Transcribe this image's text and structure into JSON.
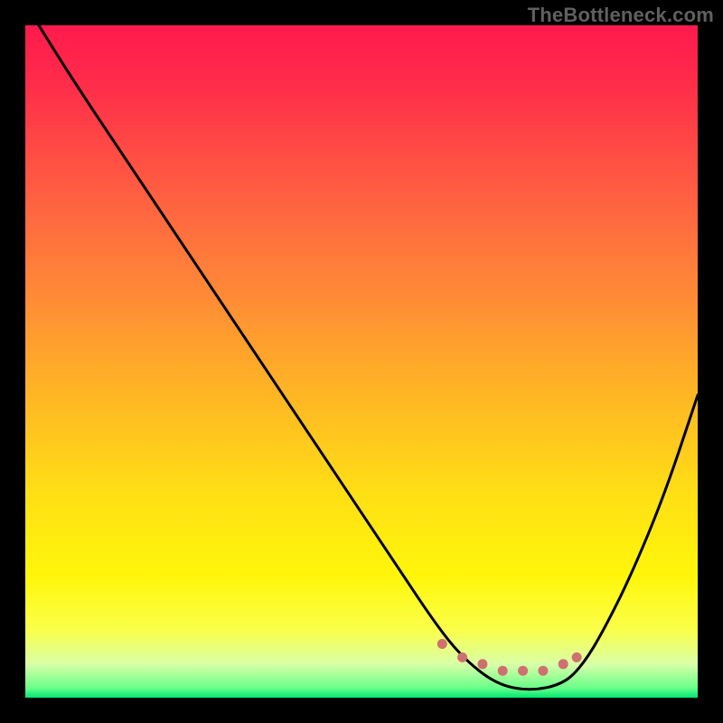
{
  "watermark": "TheBottleneck.com",
  "chart_data": {
    "type": "line",
    "title": "",
    "xlabel": "",
    "ylabel": "",
    "xlim": [
      0,
      100
    ],
    "ylim": [
      0,
      100
    ],
    "grid": false,
    "legend": false,
    "gradient_background": {
      "top_color": "#ff1a4d",
      "middle_color": "#ffe015",
      "bottom_color": "#00e874"
    },
    "series": [
      {
        "name": "bottleneck-curve",
        "color": "#000000",
        "x": [
          2,
          7,
          15,
          25,
          35,
          45,
          55,
          61,
          65,
          70,
          75,
          80,
          83,
          86,
          90,
          95,
          100
        ],
        "values": [
          100,
          92,
          80,
          65,
          50,
          35,
          20,
          11,
          6,
          2,
          1,
          2,
          5,
          10,
          18,
          30,
          45
        ]
      }
    ],
    "highlight_points": {
      "name": "optimal-range",
      "color": "#cf7070",
      "x": [
        62,
        65,
        68,
        71,
        74,
        77,
        80,
        82
      ],
      "values": [
        8,
        6,
        5,
        4,
        4,
        4,
        5,
        6
      ]
    }
  }
}
